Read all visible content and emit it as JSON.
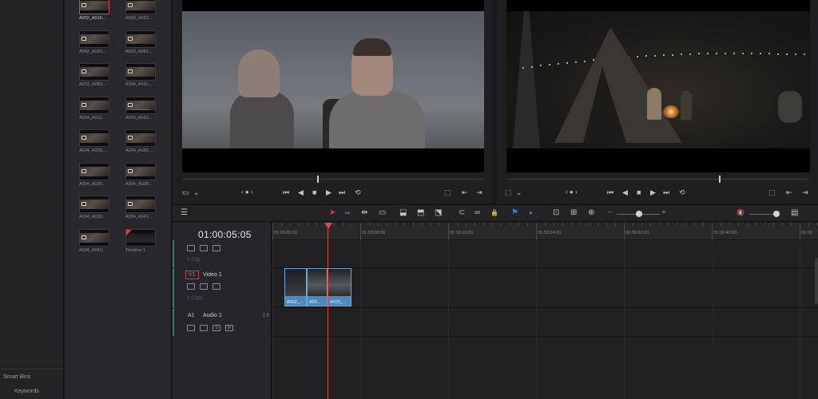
{
  "sidebar": {
    "smart_bins": "Smart Bins",
    "keywords": "Keywords"
  },
  "media_pool": {
    "clips": [
      {
        "name": "A002_A016...",
        "selected": true,
        "icon": "video-clip-icon"
      },
      {
        "name": "A002_A022...",
        "icon": "video-clip-icon"
      },
      {
        "name": "A002_A033...",
        "icon": "video-clip-icon"
      },
      {
        "name": "A002_A081...",
        "icon": "video-clip-icon"
      },
      {
        "name": "A003_A089...",
        "icon": "video-clip-icon"
      },
      {
        "name": "A004_A011...",
        "icon": "video-clip-icon"
      },
      {
        "name": "A004_A012...",
        "icon": "video-clip-icon"
      },
      {
        "name": "A004_A023...",
        "icon": "video-clip-icon",
        "in_use": true
      },
      {
        "name": "A004_A028...",
        "icon": "video-clip-icon"
      },
      {
        "name": "A004_A030...",
        "icon": "video-clip-icon"
      },
      {
        "name": "A004_A036...",
        "icon": "video-clip-icon"
      },
      {
        "name": "A004_A038...",
        "icon": "video-clip-icon"
      },
      {
        "name": "A004_A039...",
        "icon": "video-clip-icon"
      },
      {
        "name": "A004_A041...",
        "icon": "video-clip-icon"
      },
      {
        "name": "A004_A042...",
        "icon": "video-clip-icon"
      },
      {
        "name": "Timeline 1",
        "icon": "timeline-icon"
      }
    ]
  },
  "source_viewer": {
    "icons": [
      "viewer-mode-icon",
      "dropdown-icon",
      "jog-prev-icon",
      "jog-dot-icon",
      "jog-next-icon",
      "first-frame-icon",
      "reverse-icon",
      "stop-icon",
      "play-icon",
      "last-frame-icon",
      "loop-icon",
      "in-out-icon",
      "mark-in-icon",
      "mark-out-icon"
    ],
    "glyphs": {
      "mode": "▭",
      "dropdown": "⌄",
      "jog": "‹ ● ›",
      "first": "⏮",
      "rev": "◀",
      "stop": "■",
      "play": "▶",
      "last": "⏭",
      "loop": "⟲",
      "inout": "⬚",
      "markin": "⇤",
      "markout": "⇥"
    }
  },
  "record_viewer": {
    "glyphs": {
      "mode": "⬚",
      "dropdown": "⌄",
      "jog": "‹ ● ›",
      "first": "⏮",
      "rev": "◀",
      "stop": "■",
      "play": "▶",
      "last": "⏭",
      "loop": "⟲",
      "inout": "⬚",
      "markin": "⇤",
      "markout": "⇥"
    }
  },
  "toolbar": {
    "glyphs": {
      "layout": "☰",
      "select": "➤",
      "trim": "⇔",
      "dynamic_trim": "⇹",
      "blade": "▭",
      "insert": "⬓",
      "overwrite": "⬒",
      "replace": "⬔",
      "snap": "⊂",
      "link": "∞",
      "lock": "🔒",
      "flag": "⚑",
      "marker": "●",
      "zoom_full": "⊡",
      "zoom_detail": "⊞",
      "zoom_custom": "⊕",
      "minus": "−",
      "plus": "+",
      "mute": "🔇",
      "meter": "▤"
    },
    "flag_color": "#3d7be0",
    "select_color": "#e0413a"
  },
  "timeline": {
    "timecode": "01:00:05:05",
    "ruler_labels": [
      "01:00:00:00",
      "01:00:08:00",
      "01:00:16:00",
      "01:00:24:00",
      "01:00:32:00",
      "01:00:40:00",
      "01:00"
    ],
    "tracks": [
      {
        "id": "",
        "name": "",
        "clips_label": "0 Clip"
      },
      {
        "id": "V1",
        "name": "Video 1",
        "clips_label": "2 Clips"
      },
      {
        "id": "A1",
        "name": "Audio 1",
        "clips_label": "",
        "level": "2.0",
        "solo": "S",
        "mute": "M"
      }
    ],
    "video_clips": [
      {
        "label": "A002_..."
      },
      {
        "label": "A00...",
        "linked": true
      },
      {
        "label": "A023_..."
      }
    ],
    "playhead_color": "#e04848"
  }
}
